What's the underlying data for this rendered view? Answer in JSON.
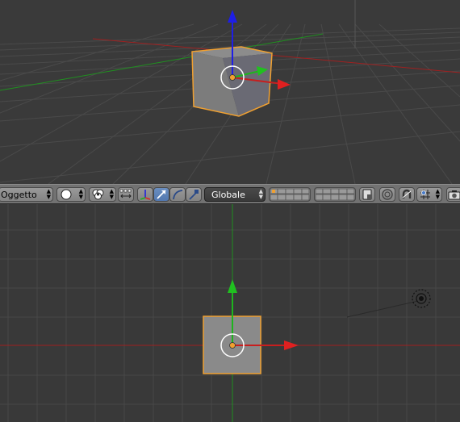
{
  "header": {
    "object_mode_label": "Oggetto",
    "transform_orientation_label": "Globale"
  },
  "icons": {
    "mode_arrows": "up-down-arrows-icon",
    "viewport_shading": "solid-sphere-icon",
    "pivot": "pivot-point-icon",
    "manipulator_toggle": "manipulator-axes-icon",
    "translate": "translate-arrow-icon",
    "rotate": "rotate-arc-icon",
    "scale": "scale-handle-icon",
    "layers": "layer-grid-icon",
    "lock_camera": "lock-layer-icon",
    "proportional_edit": "proportional-edit-icon",
    "snap_toggle": "magnet-icon",
    "snap_element": "snap-increment-icon",
    "render": "camera-icon"
  },
  "colors": {
    "x_axis": "#c81e1e",
    "y_axis": "#1eb41e",
    "z_axis": "#1e1ee6",
    "selection": "#f0a030",
    "active_tool": "#5b80b8"
  }
}
